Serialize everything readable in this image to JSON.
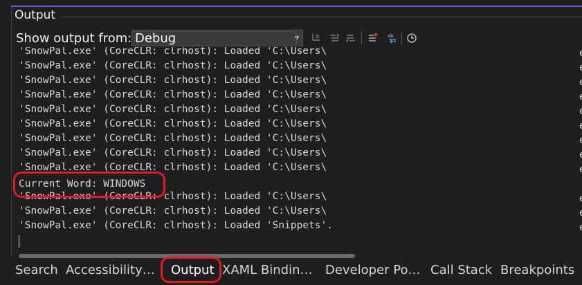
{
  "panel": {
    "title": "Output"
  },
  "toolbar": {
    "show_output_label": "Show output from:",
    "source_selected": "Debug",
    "buttons": [
      {
        "name": "find-message-in-code-icon"
      },
      {
        "name": "go-to-previous-message-icon"
      },
      {
        "name": "go-to-next-message-icon"
      },
      {
        "name": "clear-all-icon"
      },
      {
        "name": "toggle-word-wrap-icon"
      },
      {
        "name": "toggle-timestamp-icon"
      }
    ]
  },
  "output": {
    "lines": [
      "'SnowPal.exe' (CoreCLR: clrhost): Loaded 'C:\\Users\\",
      "'SnowPal.exe' (CoreCLR: clrhost): Loaded 'C:\\Users\\",
      "'SnowPal.exe' (CoreCLR: clrhost): Loaded 'C:\\Users\\",
      "'SnowPal.exe' (CoreCLR: clrhost): Loaded 'C:\\Users\\",
      "'SnowPal.exe' (CoreCLR: clrhost): Loaded 'C:\\Users\\",
      "'SnowPal.exe' (CoreCLR: clrhost): Loaded 'C:\\Users\\",
      "'SnowPal.exe' (CoreCLR: clrhost): Loaded 'C:\\Users\\",
      "'SnowPal.exe' (CoreCLR: clrhost): Loaded 'C:\\Users\\",
      "'SnowPal.exe' (CoreCLR: clrhost): Loaded 'C:\\Users\\",
      "Current Word: WINDOWS",
      "'SnowPal.exe' (CoreCLR: clrhost): Loaded 'C:\\Users\\",
      "'SnowPal.exe' (CoreCLR: clrhost): Loaded 'C:\\Users\\",
      "'SnowPal.exe' (CoreCLR: clrhost): Loaded 'Snippets'."
    ],
    "right_edge_char": "e"
  },
  "tabs": [
    {
      "label": "Search"
    },
    {
      "label": "Accessibility…"
    },
    {
      "label": "Output",
      "active": true
    },
    {
      "label": "XAML Bindin…"
    },
    {
      "label": "Developer Po…"
    },
    {
      "label": "Call Stack"
    },
    {
      "label": "Breakpoints"
    }
  ],
  "colors": {
    "accent": "#6d5bd0",
    "highlight": "#e41b23"
  }
}
